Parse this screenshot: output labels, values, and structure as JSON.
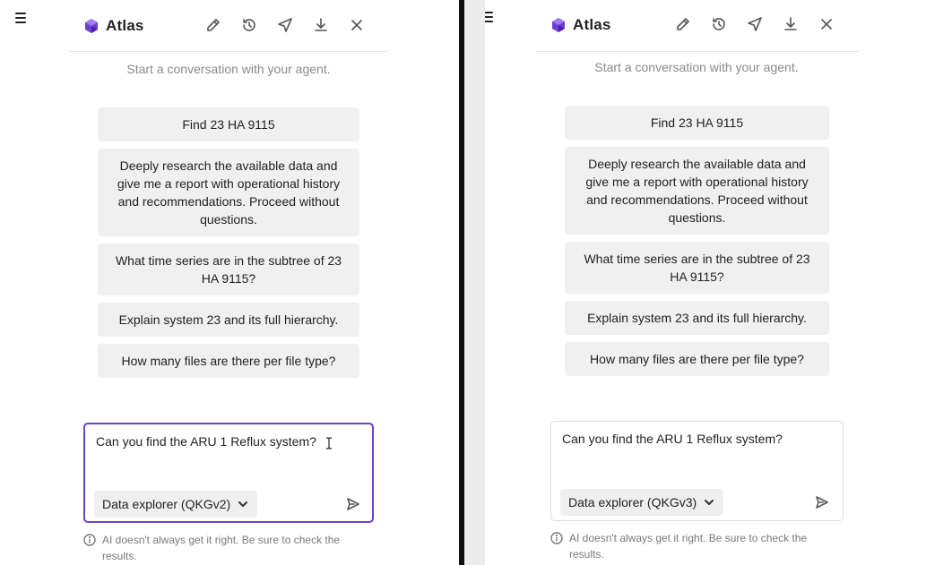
{
  "app": {
    "name": "Atlas"
  },
  "toolbar": {
    "edit_icon": "edit-icon",
    "history_icon": "history-icon",
    "send_icon": "send-icon",
    "download_icon": "download-icon",
    "close_icon": "close-icon"
  },
  "intro_text": "Start a conversation with your agent.",
  "suggestions": [
    "Find 23 HA 9115",
    "Deeply research the available data and give me a report with operational history and recommendations. Proceed without questions.",
    "What time series are in the subtree of 23 HA 9115?",
    "Explain system 23 and its full hierarchy.",
    "How many files are there per file type?"
  ],
  "left_pane": {
    "input_value": "Can you find the ARU 1 Reflux system?",
    "model": "Data explorer (QKGv2)",
    "focused": true
  },
  "right_pane": {
    "input_value": "Can you find the ARU 1 Reflux system?",
    "model": "Data explorer (QKGv3)",
    "focused": false
  },
  "disclaimer": "AI doesn't always get it right. Be sure to check the results.",
  "colors": {
    "accent": "#6c3fd1",
    "suggestion_bg": "#f0f0f0",
    "divider": "#111111"
  }
}
